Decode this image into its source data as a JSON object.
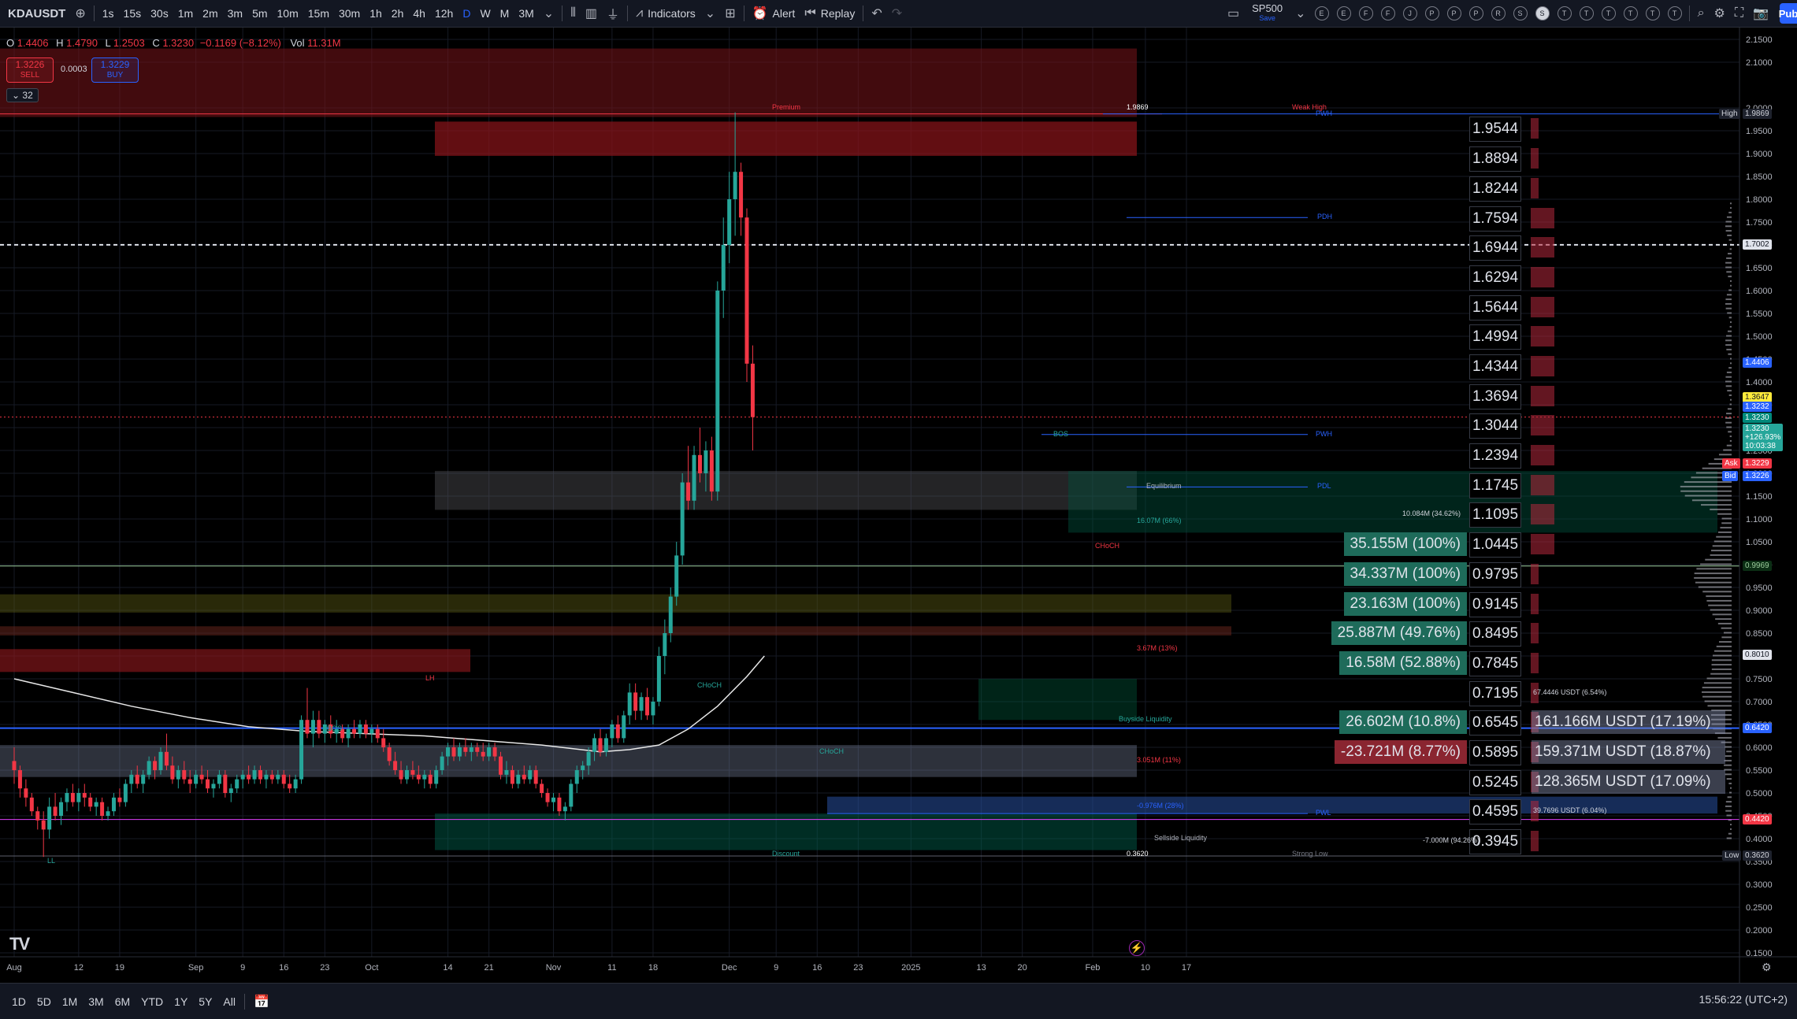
{
  "toolbar": {
    "symbol": "KDAUSDT",
    "intervals": [
      "1s",
      "15s",
      "30s",
      "1m",
      "2m",
      "3m",
      "5m",
      "10m",
      "15m",
      "30m",
      "1h",
      "2h",
      "4h",
      "12h",
      "D",
      "W",
      "M",
      "3M"
    ],
    "active_interval": "D",
    "indicators_label": "Indicators",
    "alert_label": "Alert",
    "replay_label": "Replay",
    "layout_name": "SP500",
    "layout_status": "Save",
    "watch_buttons": [
      "E",
      "E",
      "F",
      "F",
      "J",
      "P",
      "P",
      "P",
      "R",
      "S",
      "S",
      "T",
      "T",
      "T",
      "T",
      "T",
      "T"
    ],
    "active_watch_index": 10,
    "publish_label": "Pub"
  },
  "legend": {
    "open_label": "O",
    "open": "1.4406",
    "high_label": "H",
    "high": "1.4790",
    "low_label": "L",
    "low": "1.2503",
    "close_label": "C",
    "close": "1.3230",
    "change": "−0.1169 (−8.12%)",
    "vol_label": "Vol",
    "vol": "11.31M",
    "sell_price": "1.3226",
    "sell_label": "SELL",
    "spread": "0.0003",
    "buy_price": "1.3229",
    "buy_label": "BUY",
    "indicator_count": "32"
  },
  "colors": {
    "up": "#26a69a",
    "down": "#f23645",
    "accent": "#2962ff",
    "bg": "#000000",
    "panel": "#131722"
  },
  "chart_data": {
    "type": "candlestick",
    "symbol": "KDAUSDT",
    "interval": "D",
    "ylim": [
      0.1,
      2.2
    ],
    "y_ticks": [
      "2.1500",
      "2.1000",
      "2.0000",
      "1.9500",
      "1.9000",
      "1.8500",
      "1.8000",
      "1.7500",
      "1.7000",
      "1.6500",
      "1.6000",
      "1.5500",
      "1.5000",
      "1.4500",
      "1.4000",
      "1.3500",
      "1.3000",
      "1.2500",
      "1.2000",
      "1.1500",
      "1.1000",
      "1.0500",
      "1.0000",
      "0.9500",
      "0.9000",
      "0.8500",
      "0.8000",
      "0.7500",
      "0.7000",
      "0.6500",
      "0.6000",
      "0.5500",
      "0.5000",
      "0.4500",
      "0.4000",
      "0.3500",
      "0.3000",
      "0.2500",
      "0.2000",
      "0.1500"
    ],
    "x_ticks": [
      {
        "label": "Aug",
        "day": 0
      },
      {
        "label": "12",
        "day": 11
      },
      {
        "label": "19",
        "day": 18
      },
      {
        "label": "Sep",
        "day": 31
      },
      {
        "label": "9",
        "day": 39
      },
      {
        "label": "16",
        "day": 46
      },
      {
        "label": "23",
        "day": 53
      },
      {
        "label": "Oct",
        "day": 61
      },
      {
        "label": "14",
        "day": 74
      },
      {
        "label": "21",
        "day": 81
      },
      {
        "label": "Nov",
        "day": 92
      },
      {
        "label": "11",
        "day": 102
      },
      {
        "label": "18",
        "day": 109
      },
      {
        "label": "Dec",
        "day": 122
      },
      {
        "label": "9",
        "day": 130
      },
      {
        "label": "16",
        "day": 137
      },
      {
        "label": "23",
        "day": 144
      },
      {
        "label": "2025",
        "day": 153
      },
      {
        "label": "13",
        "day": 165
      },
      {
        "label": "20",
        "day": 172
      },
      {
        "label": "Feb",
        "day": 184
      },
      {
        "label": "10",
        "day": 193
      },
      {
        "label": "17",
        "day": 200
      }
    ],
    "x_domain": [
      0,
      204
    ],
    "candles": [
      [
        0.57,
        0.6,
        0.52,
        0.55
      ],
      [
        0.55,
        0.56,
        0.49,
        0.51
      ],
      [
        0.51,
        0.53,
        0.47,
        0.49
      ],
      [
        0.49,
        0.5,
        0.45,
        0.46
      ],
      [
        0.46,
        0.47,
        0.42,
        0.44
      ],
      [
        0.44,
        0.46,
        0.36,
        0.42
      ],
      [
        0.42,
        0.49,
        0.4,
        0.47
      ],
      [
        0.47,
        0.5,
        0.44,
        0.45
      ],
      [
        0.45,
        0.49,
        0.43,
        0.48
      ],
      [
        0.48,
        0.51,
        0.46,
        0.5
      ],
      [
        0.5,
        0.52,
        0.47,
        0.48
      ],
      [
        0.48,
        0.51,
        0.46,
        0.5
      ],
      [
        0.5,
        0.52,
        0.47,
        0.49
      ],
      [
        0.49,
        0.5,
        0.46,
        0.47
      ],
      [
        0.47,
        0.49,
        0.45,
        0.48
      ],
      [
        0.48,
        0.49,
        0.44,
        0.45
      ],
      [
        0.45,
        0.47,
        0.44,
        0.46
      ],
      [
        0.46,
        0.5,
        0.45,
        0.49
      ],
      [
        0.49,
        0.51,
        0.47,
        0.48
      ],
      [
        0.48,
        0.53,
        0.47,
        0.52
      ],
      [
        0.52,
        0.55,
        0.5,
        0.54
      ],
      [
        0.54,
        0.56,
        0.51,
        0.52
      ],
      [
        0.52,
        0.55,
        0.5,
        0.54
      ],
      [
        0.54,
        0.58,
        0.53,
        0.57
      ],
      [
        0.57,
        0.58,
        0.53,
        0.55
      ],
      [
        0.55,
        0.6,
        0.54,
        0.59
      ],
      [
        0.59,
        0.63,
        0.55,
        0.56
      ],
      [
        0.56,
        0.58,
        0.52,
        0.53
      ],
      [
        0.53,
        0.56,
        0.51,
        0.55
      ],
      [
        0.55,
        0.57,
        0.52,
        0.53
      ],
      [
        0.53,
        0.55,
        0.5,
        0.52
      ],
      [
        0.52,
        0.55,
        0.51,
        0.54
      ],
      [
        0.54,
        0.56,
        0.52,
        0.53
      ],
      [
        0.53,
        0.55,
        0.5,
        0.51
      ],
      [
        0.51,
        0.53,
        0.49,
        0.52
      ],
      [
        0.52,
        0.55,
        0.51,
        0.54
      ],
      [
        0.54,
        0.55,
        0.49,
        0.5
      ],
      [
        0.5,
        0.52,
        0.48,
        0.51
      ],
      [
        0.51,
        0.54,
        0.5,
        0.53
      ],
      [
        0.53,
        0.55,
        0.51,
        0.54
      ],
      [
        0.54,
        0.56,
        0.52,
        0.53
      ],
      [
        0.53,
        0.56,
        0.52,
        0.55
      ],
      [
        0.55,
        0.56,
        0.52,
        0.53
      ],
      [
        0.53,
        0.55,
        0.51,
        0.54
      ],
      [
        0.54,
        0.55,
        0.52,
        0.53
      ],
      [
        0.53,
        0.55,
        0.52,
        0.54
      ],
      [
        0.54,
        0.55,
        0.51,
        0.52
      ],
      [
        0.52,
        0.54,
        0.5,
        0.51
      ],
      [
        0.51,
        0.54,
        0.5,
        0.53
      ],
      [
        0.53,
        0.67,
        0.52,
        0.66
      ],
      [
        0.66,
        0.73,
        0.62,
        0.63
      ],
      [
        0.63,
        0.68,
        0.6,
        0.66
      ],
      [
        0.66,
        0.68,
        0.62,
        0.63
      ],
      [
        0.63,
        0.66,
        0.61,
        0.65
      ],
      [
        0.65,
        0.67,
        0.62,
        0.63
      ],
      [
        0.63,
        0.66,
        0.61,
        0.64
      ],
      [
        0.64,
        0.65,
        0.61,
        0.62
      ],
      [
        0.62,
        0.65,
        0.6,
        0.64
      ],
      [
        0.64,
        0.66,
        0.62,
        0.63
      ],
      [
        0.63,
        0.66,
        0.62,
        0.65
      ],
      [
        0.65,
        0.66,
        0.62,
        0.63
      ],
      [
        0.63,
        0.65,
        0.61,
        0.64
      ],
      [
        0.64,
        0.65,
        0.61,
        0.62
      ],
      [
        0.62,
        0.64,
        0.59,
        0.6
      ],
      [
        0.6,
        0.61,
        0.56,
        0.57
      ],
      [
        0.57,
        0.59,
        0.54,
        0.55
      ],
      [
        0.55,
        0.57,
        0.52,
        0.53
      ],
      [
        0.53,
        0.56,
        0.52,
        0.55
      ],
      [
        0.55,
        0.57,
        0.53,
        0.54
      ],
      [
        0.54,
        0.56,
        0.52,
        0.53
      ],
      [
        0.53,
        0.55,
        0.51,
        0.54
      ],
      [
        0.54,
        0.55,
        0.51,
        0.52
      ],
      [
        0.52,
        0.56,
        0.51,
        0.55
      ],
      [
        0.55,
        0.59,
        0.54,
        0.58
      ],
      [
        0.58,
        0.61,
        0.56,
        0.6
      ],
      [
        0.6,
        0.62,
        0.57,
        0.58
      ],
      [
        0.58,
        0.61,
        0.57,
        0.6
      ],
      [
        0.6,
        0.62,
        0.58,
        0.59
      ],
      [
        0.59,
        0.61,
        0.57,
        0.6
      ],
      [
        0.6,
        0.61,
        0.58,
        0.59
      ],
      [
        0.59,
        0.61,
        0.57,
        0.58
      ],
      [
        0.58,
        0.61,
        0.57,
        0.6
      ],
      [
        0.6,
        0.61,
        0.57,
        0.58
      ],
      [
        0.58,
        0.59,
        0.53,
        0.54
      ],
      [
        0.54,
        0.57,
        0.52,
        0.55
      ],
      [
        0.55,
        0.56,
        0.51,
        0.52
      ],
      [
        0.52,
        0.55,
        0.51,
        0.54
      ],
      [
        0.54,
        0.56,
        0.52,
        0.53
      ],
      [
        0.53,
        0.56,
        0.52,
        0.55
      ],
      [
        0.55,
        0.56,
        0.51,
        0.52
      ],
      [
        0.52,
        0.53,
        0.49,
        0.5
      ],
      [
        0.5,
        0.51,
        0.47,
        0.48
      ],
      [
        0.48,
        0.5,
        0.46,
        0.49
      ],
      [
        0.49,
        0.5,
        0.45,
        0.46
      ],
      [
        0.46,
        0.48,
        0.44,
        0.47
      ],
      [
        0.47,
        0.53,
        0.46,
        0.52
      ],
      [
        0.52,
        0.56,
        0.5,
        0.55
      ],
      [
        0.55,
        0.57,
        0.53,
        0.56
      ],
      [
        0.56,
        0.6,
        0.54,
        0.59
      ],
      [
        0.59,
        0.63,
        0.57,
        0.62
      ],
      [
        0.62,
        0.64,
        0.58,
        0.59
      ],
      [
        0.59,
        0.63,
        0.58,
        0.62
      ],
      [
        0.62,
        0.66,
        0.6,
        0.65
      ],
      [
        0.65,
        0.67,
        0.61,
        0.62
      ],
      [
        0.62,
        0.68,
        0.61,
        0.67
      ],
      [
        0.67,
        0.74,
        0.65,
        0.72
      ],
      [
        0.72,
        0.74,
        0.66,
        0.68
      ],
      [
        0.68,
        0.72,
        0.66,
        0.71
      ],
      [
        0.71,
        0.73,
        0.66,
        0.67
      ],
      [
        0.67,
        0.71,
        0.65,
        0.7
      ],
      [
        0.7,
        0.82,
        0.69,
        0.8
      ],
      [
        0.8,
        0.88,
        0.76,
        0.85
      ],
      [
        0.85,
        0.95,
        0.83,
        0.93
      ],
      [
        0.93,
        1.05,
        0.91,
        1.02
      ],
      [
        1.02,
        1.2,
        1.0,
        1.18
      ],
      [
        1.18,
        1.26,
        1.12,
        1.14
      ],
      [
        1.14,
        1.26,
        1.12,
        1.24
      ],
      [
        1.24,
        1.3,
        1.18,
        1.2
      ],
      [
        1.2,
        1.27,
        1.16,
        1.25
      ],
      [
        1.25,
        1.28,
        1.14,
        1.16
      ],
      [
        1.16,
        1.62,
        1.14,
        1.6
      ],
      [
        1.6,
        1.76,
        1.54,
        1.7
      ],
      [
        1.7,
        1.86,
        1.66,
        1.8
      ],
      [
        1.8,
        1.99,
        1.72,
        1.86
      ],
      [
        1.86,
        1.88,
        1.72,
        1.76
      ],
      [
        1.76,
        1.78,
        1.4,
        1.44
      ],
      [
        1.44,
        1.48,
        1.25,
        1.323
      ]
    ],
    "moving_average": [
      {
        "day": 0,
        "value": 0.75
      },
      {
        "day": 10,
        "value": 0.72
      },
      {
        "day": 20,
        "value": 0.69
      },
      {
        "day": 30,
        "value": 0.665
      },
      {
        "day": 40,
        "value": 0.645
      },
      {
        "day": 50,
        "value": 0.635
      },
      {
        "day": 60,
        "value": 0.63
      },
      {
        "day": 70,
        "value": 0.625
      },
      {
        "day": 80,
        "value": 0.615
      },
      {
        "day": 90,
        "value": 0.605
      },
      {
        "day": 100,
        "value": 0.59
      },
      {
        "day": 105,
        "value": 0.595
      },
      {
        "day": 110,
        "value": 0.605
      },
      {
        "day": 115,
        "value": 0.64
      },
      {
        "day": 120,
        "value": 0.69
      },
      {
        "day": 125,
        "value": 0.755
      },
      {
        "day": 128,
        "value": 0.8
      }
    ],
    "price_levels": [
      "1.9544",
      "1.8894",
      "1.8244",
      "1.7594",
      "1.6944",
      "1.6294",
      "1.5644",
      "1.4994",
      "1.4344",
      "1.3694",
      "1.3044",
      "1.2394",
      "1.1745",
      "1.1095",
      "1.0445",
      "0.9795",
      "0.9145",
      "0.8495",
      "0.7845",
      "0.7195",
      "0.6545",
      "0.5895",
      "0.5245",
      "0.4595",
      "0.3945"
    ],
    "orderbook_labels": [
      {
        "level": "1.0445",
        "text": "35.155M (100%)",
        "color": "#1e6b5a"
      },
      {
        "level": "0.9795",
        "text": "34.337M (100%)",
        "color": "#1e6b5a"
      },
      {
        "level": "0.9145",
        "text": "23.163M (100%)",
        "color": "#1e6b5a"
      },
      {
        "level": "0.8495",
        "text": "25.887M (49.76%)",
        "color": "#1e6b5a"
      },
      {
        "level": "0.7845",
        "text": "16.58M (52.88%)",
        "color": "#1e6b5a"
      },
      {
        "level": "0.6545",
        "text": "26.602M (10.8%)",
        "color": "#1e6b5a"
      },
      {
        "level": "0.5895",
        "text": "-23.721M (8.77%)",
        "color": "#8a2530"
      }
    ],
    "usdt_labels": [
      {
        "level": "0.6545",
        "text": "161.166M USDT (17.19%)"
      },
      {
        "level": "0.5895",
        "text": "159.371M USDT (18.87%)"
      },
      {
        "level": "0.5245",
        "text": "128.365M USDT (17.09%)"
      }
    ],
    "small_labels": {
      "small_1": "10.084M (34.62%)",
      "small_2": "16.07M (66%)",
      "small_3": "3.67M (13%)",
      "small_4": "67.4446 USDT (6.54%)",
      "small_5": "39.7696 USDT (6.04%)",
      "small_6": "-7.000M (94.26%)",
      "small_7": "3.051M (11%)",
      "small_8": "-0.976M (28%)"
    },
    "zone_labels": {
      "premium": "Premium",
      "discount": "Discount",
      "equilibrium": "Equilibrium",
      "sellside": "Sellside Liquidity",
      "buyside": "Buyside Liquidity",
      "pwh": "PWH",
      "pdh": "PDH",
      "pdl": "PDL",
      "pwl": "PWL",
      "weak_high": "Weak High",
      "strong_low": "Strong Low",
      "high_marker": "1.9869",
      "low_marker": "0.3620",
      "choch": "CHoCH",
      "bos": "BOS",
      "ll": "LL",
      "lh": "LH"
    },
    "axis_tags": {
      "high_label": "High",
      "high_value": "1.9869",
      "crosshair": "1.7002",
      "open_tag": "1.4406",
      "yellow_tag": "1.3647",
      "blue_tag": "1.3232",
      "green_tag": "1.3230",
      "last_price": "1.3230",
      "last_change": "+126.93%",
      "countdown": "10:03:38",
      "ask_label": "Ask",
      "ask_value": "1.3229",
      "bid_label": "Bid",
      "bid_value": "1.3226",
      "green_line": "0.9969",
      "ma_tag": "0.8010",
      "blue_line": "0.6420",
      "red_line": "0.4420",
      "low_label": "Low",
      "low_value": "0.3620"
    }
  },
  "bottom": {
    "ranges": [
      "1D",
      "5D",
      "1M",
      "3M",
      "6M",
      "YTD",
      "1Y",
      "5Y",
      "All"
    ],
    "clock": "15:56:22 (UTC+2)"
  }
}
